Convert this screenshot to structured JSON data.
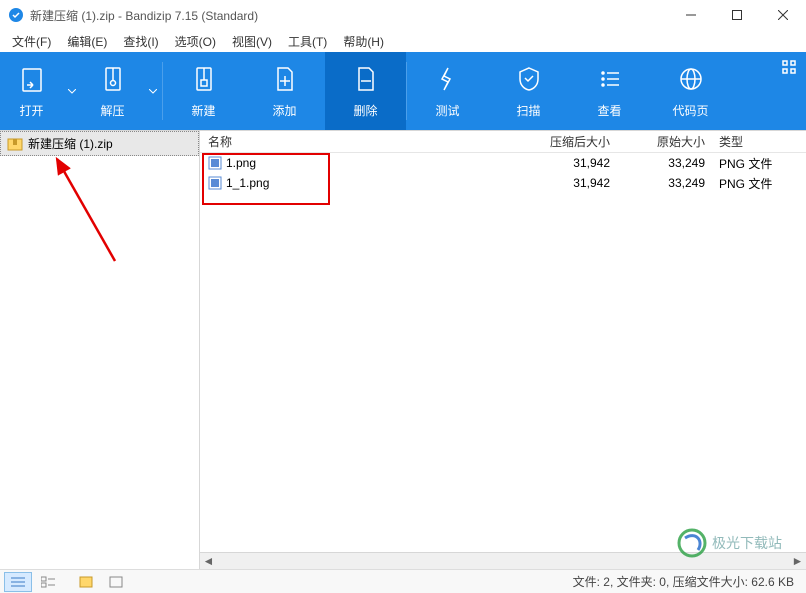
{
  "window": {
    "title": "新建压缩 (1).zip - Bandizip 7.15 (Standard)"
  },
  "menu": {
    "file": "文件(F)",
    "edit": "编辑(E)",
    "find": "查找(I)",
    "options": "选项(O)",
    "view": "视图(V)",
    "tools": "工具(T)",
    "help": "帮助(H)"
  },
  "toolbar": {
    "open": "打开",
    "extract": "解压",
    "new": "新建",
    "add": "添加",
    "delete": "删除",
    "test": "测试",
    "scan": "扫描",
    "view": "查看",
    "codepage": "代码页"
  },
  "tree": {
    "root": "新建压缩 (1).zip"
  },
  "columns": {
    "name": "名称",
    "compressed": "压缩后大小",
    "original": "原始大小",
    "type": "类型"
  },
  "files": [
    {
      "name": "1.png",
      "compressed": "31,942",
      "original": "33,249",
      "type": "PNG 文件"
    },
    {
      "name": "1_1.png",
      "compressed": "31,942",
      "original": "33,249",
      "type": "PNG 文件"
    }
  ],
  "status": {
    "text": "文件: 2, 文件夹: 0, 压缩文件大小: 62.6 KB"
  },
  "watermark": "极光下载站"
}
